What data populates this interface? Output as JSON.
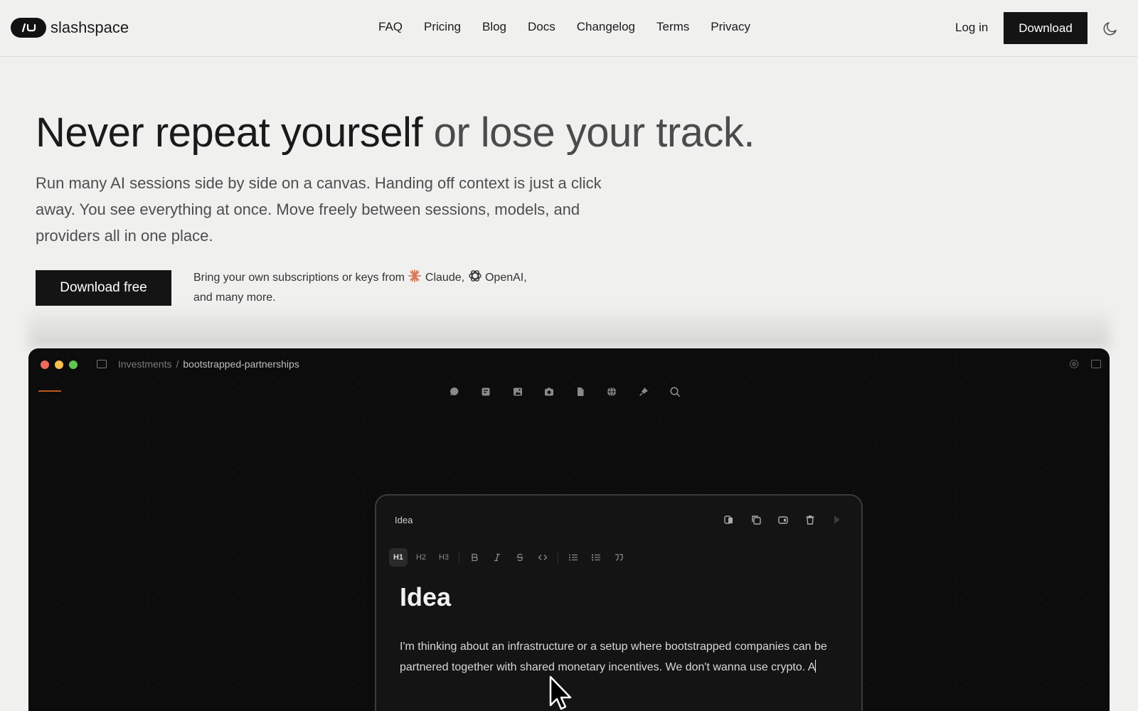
{
  "header": {
    "brand": "slashspace",
    "nav": [
      "FAQ",
      "Pricing",
      "Blog",
      "Docs",
      "Changelog",
      "Terms",
      "Privacy"
    ],
    "login": "Log in",
    "download": "Download",
    "theme_toggle_icon": "moon-icon"
  },
  "hero": {
    "title_dark": "Never repeat yourself",
    "title_light": " or lose your track.",
    "subtitle": "Run many AI sessions side by side on a canvas. Handing off context is just a click away. You see everything at once. Move freely between sessions, models, and providers all in one place.",
    "cta": "Download free",
    "byok_prefix": "Bring your own subscriptions or keys from ",
    "claude": "Claude,",
    "openai": "OpenAI,",
    "byok_suffix": "and many more."
  },
  "app": {
    "breadcrumb_parent": "Investments",
    "breadcrumb_sep": "/",
    "breadcrumb_current": "bootstrapped-partnerships",
    "toolbar_icons": [
      "chat-icon",
      "note-icon",
      "image-icon",
      "camera-icon",
      "file-icon",
      "globe-icon",
      "pin-icon",
      "search-icon"
    ],
    "note": {
      "label": "Idea",
      "format_buttons": [
        "H1",
        "H2",
        "H3"
      ],
      "heading": "Idea",
      "body": "I'm thinking about an infrastructure or a setup where bootstrapped companies can be partnered together with shared monetary incentives. We don't wanna use crypto. A"
    }
  },
  "colors": {
    "page_bg": "#f0f0ef",
    "button_dark": "#141414",
    "app_bg": "#0c0c0c",
    "accent_orange": "#b9581d",
    "claude_orange": "#d97757"
  }
}
